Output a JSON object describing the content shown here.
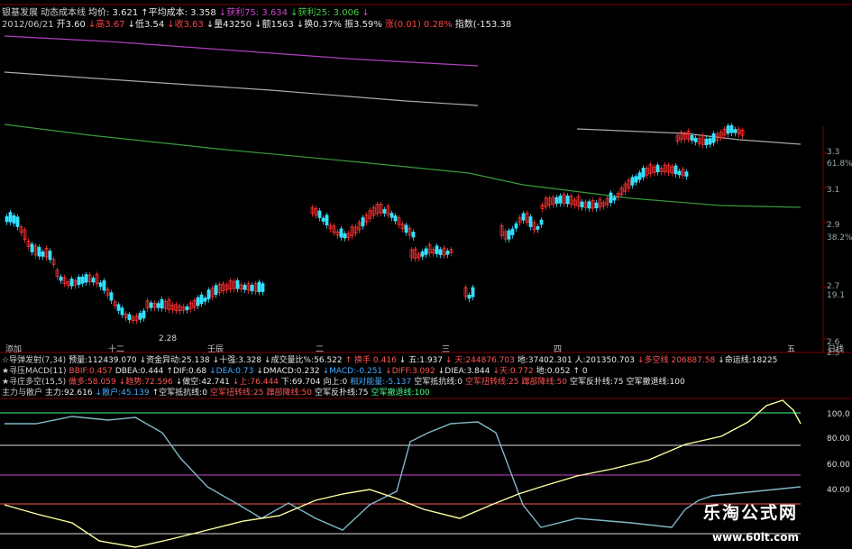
{
  "header": {
    "line1": [
      {
        "t": "银基发展",
        "c": "#d0d0d0"
      },
      {
        "t": "动态成本线",
        "c": "#d0d0d0"
      },
      {
        "t": "均价: 3.621",
        "c": "#e8e8e8"
      },
      {
        "t": "↑平均成本: 3.358",
        "c": "#e8e8e8"
      },
      {
        "t": "↓获利75: 3.634",
        "c": "#cc44cc"
      },
      {
        "t": "↓获利25: 3.006",
        "c": "#44cc44"
      },
      {
        "t": "↓",
        "c": "#cc44cc"
      }
    ],
    "line2": [
      {
        "t": "2012/06/21",
        "c": "#c8c8c8"
      },
      {
        "t": "开3.60",
        "c": "#e8e8e8"
      },
      {
        "t": "↓高3.67",
        "c": "#ff4444"
      },
      {
        "t": "↓低3.54",
        "c": "#e8e8e8"
      },
      {
        "t": "↓收3.63",
        "c": "#ff4444"
      },
      {
        "t": "↓量43250",
        "c": "#e8e8e8"
      },
      {
        "t": "↓额1563",
        "c": "#e8e8e8"
      },
      {
        "t": "↓换0.37%",
        "c": "#e8e8e8"
      },
      {
        "t": "振3.59%",
        "c": "#e8e8e8"
      },
      {
        "t": "涨(0.01)",
        "c": "#ff4444"
      },
      {
        "t": "0.28%",
        "c": "#ff4444"
      },
      {
        "t": "指数(-153.38",
        "c": "#e8e8e8"
      }
    ]
  },
  "price_axis": [
    "3.3",
    "61.8%",
    "3.1",
    "2.9",
    "38.2%",
    "2.7",
    "19.1",
    "2.6",
    "2.5"
  ],
  "low_label": "2.28",
  "months": [
    "添加",
    "十二",
    "壬辰",
    "二",
    "三",
    "四",
    "五",
    "日线"
  ],
  "indicators": {
    "line1": [
      {
        "t": "☆导弹发射(7,34)",
        "c": "#d0d0d0"
      },
      {
        "t": "预量:112439.070",
        "c": "#e8e8e8"
      },
      {
        "t": "↓资金异动:25.138",
        "c": "#e8e8e8"
      },
      {
        "t": "↓十强:3.328",
        "c": "#e8e8e8"
      },
      {
        "t": "↓成交量比%:56.522",
        "c": "#e8e8e8"
      },
      {
        "t": "↑ 换手",
        "c": "#ff5555"
      },
      {
        "t": "0.416",
        "c": "#ff5555"
      },
      {
        "t": "↓ 五:1.937",
        "c": "#e8e8e8"
      },
      {
        "t": "↓ 天:244876.703",
        "c": "#ff5555"
      },
      {
        "t": "地:37402.301",
        "c": "#e8e8e8"
      },
      {
        "t": "人:201350.703",
        "c": "#e8e8e8"
      },
      {
        "t": "↓多空线",
        "c": "#ff5555"
      },
      {
        "t": "206887.58",
        "c": "#ff5555"
      },
      {
        "t": "↓命运线:18225",
        "c": "#e8e8e8"
      }
    ],
    "line2": [
      {
        "t": "★寻压MACD(11)",
        "c": "#d0d0d0"
      },
      {
        "t": "BBIF:0.457",
        "c": "#ff5555"
      },
      {
        "t": "DBEA:0.444",
        "c": "#e8e8e8"
      },
      {
        "t": "↑DIF:0.68",
        "c": "#e8e8e8"
      },
      {
        "t": "↓DEA:0.73",
        "c": "#44aaff"
      },
      {
        "t": "↓DMACD:0.232",
        "c": "#e8e8e8"
      },
      {
        "t": "↓MACD:-0.251",
        "c": "#44aaff"
      },
      {
        "t": "↓DIFF:3.092",
        "c": "#ff5555"
      },
      {
        "t": "↓DIEA:3.844",
        "c": "#e8e8e8"
      },
      {
        "t": "↓天:0.772",
        "c": "#ff5555"
      },
      {
        "t": "地:0.052",
        "c": "#e8e8e8"
      },
      {
        "t": "↑ 0",
        "c": "#e8e8e8"
      }
    ],
    "line3": [
      {
        "t": "★寻庄多空(15,5)",
        "c": "#d0d0d0"
      },
      {
        "t": "做多:58.059",
        "c": "#ff5555"
      },
      {
        "t": "↓趋势:72.596",
        "c": "#ff5555"
      },
      {
        "t": "↓做空:42.741",
        "c": "#e8e8e8"
      },
      {
        "t": "↓上:76.444",
        "c": "#ff5555"
      },
      {
        "t": "下:69.704",
        "c": "#e8e8e8"
      },
      {
        "t": "向上:0",
        "c": "#e8e8e8"
      },
      {
        "t": "相对能量:-5.137",
        "c": "#44aaff"
      },
      {
        "t": "空军抵抗线:0",
        "c": "#e8e8e8"
      },
      {
        "t": "空军扭转线:25",
        "c": "#ff5555"
      },
      {
        "t": "蹿部降线:50",
        "c": "#ff5555"
      },
      {
        "t": "空军反扑线:75",
        "c": "#e8e8e8"
      },
      {
        "t": "空军撤退线:100",
        "c": "#e8e8e8"
      }
    ],
    "line4": [
      {
        "t": "主力与散户",
        "c": "#d0d0d0"
      },
      {
        "t": "主力:92.616",
        "c": "#e8e8e8"
      },
      {
        "t": "↓散户:45.139",
        "c": "#44aaff"
      },
      {
        "t": "↑空军抵抗线:0",
        "c": "#e8e8e8"
      },
      {
        "t": "空军扭转线:25",
        "c": "#ff5555"
      },
      {
        "t": "蹿部降线:50",
        "c": "#ff5555"
      },
      {
        "t": "空军反扑线:75",
        "c": "#e8e8e8"
      },
      {
        "t": "空军撤退线:100",
        "c": "#44ff88"
      }
    ]
  },
  "osc_axis": [
    "100.0",
    "80.00",
    "60.00",
    "40.00"
  ],
  "watermark": {
    "cn": "乐淘公式网",
    "url": "www.60lt.com"
  },
  "colors": {
    "up": "#ff3333",
    "down": "#33e0ff",
    "purple": "#b040c0",
    "gray": "#aaaaaa",
    "green": "#3a9a3a",
    "main": "#ffffa0",
    "retail": "#7fb8c8"
  }
}
